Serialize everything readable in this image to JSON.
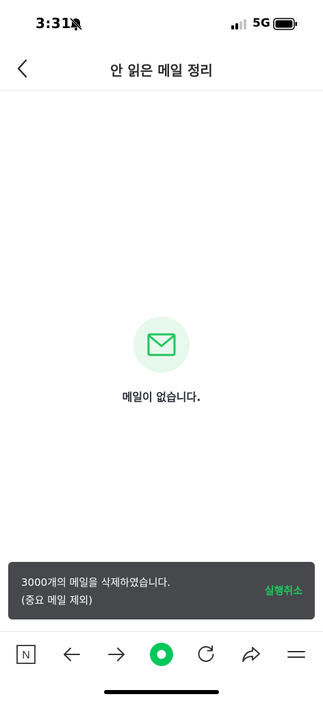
{
  "status_bar": {
    "time": "3:31",
    "network": "5G"
  },
  "header": {
    "title": "안 읽은 메일 정리"
  },
  "empty_state": {
    "message": "메일이 없습니다."
  },
  "toast": {
    "line1": "3000개의 메일을 삭제하였습니다.",
    "line2": "(중요 메일 제외)",
    "undo_label": "실행취소"
  },
  "colors": {
    "accent": "#22c55e",
    "toast_bg": "#46484c",
    "mail_icon_bg": "#e7f8ec"
  },
  "toolbar": {
    "items": [
      {
        "icon": "naver-icon"
      },
      {
        "icon": "back-arrow-icon"
      },
      {
        "icon": "forward-arrow-icon"
      },
      {
        "icon": "green-dot-icon"
      },
      {
        "icon": "refresh-icon"
      },
      {
        "icon": "share-icon"
      },
      {
        "icon": "menu-icon"
      }
    ]
  }
}
